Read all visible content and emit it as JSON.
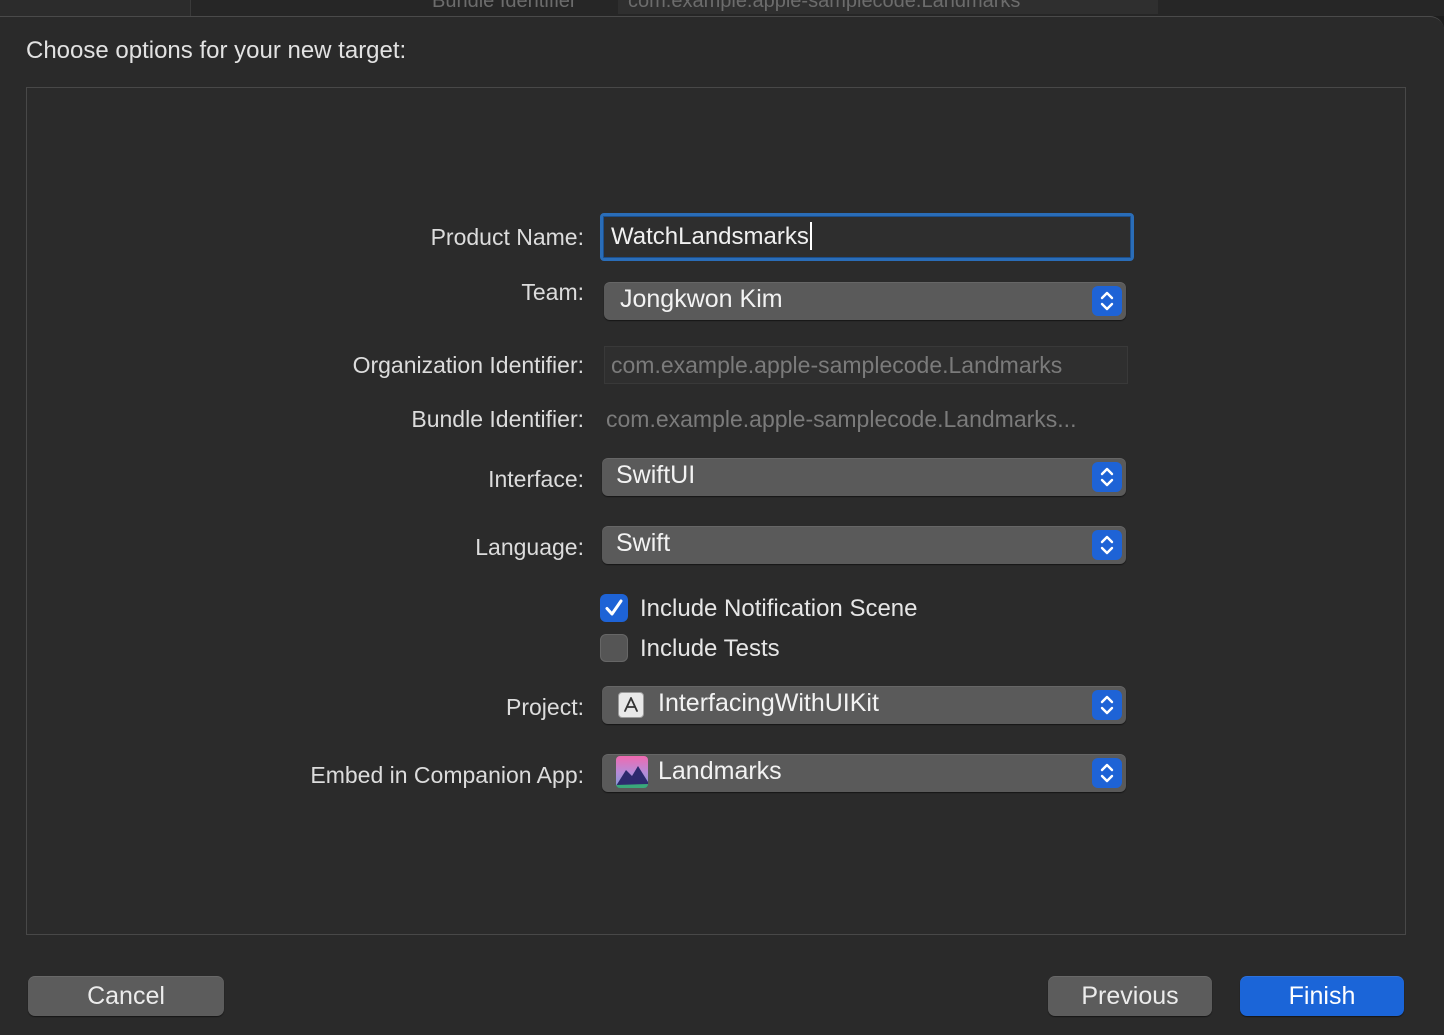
{
  "background_window": {
    "label": "Bundle Identifier",
    "value": "com.example.apple-samplecode.Landmarks"
  },
  "sheet": {
    "title": "Choose options for your new target:"
  },
  "form": {
    "product_name": {
      "label": "Product Name:",
      "value": "WatchLandsmarks"
    },
    "team": {
      "label": "Team:",
      "value": "Jongkwon Kim"
    },
    "organization_identifier": {
      "label": "Organization Identifier:",
      "placeholder": "com.example.apple-samplecode.Landmarks"
    },
    "bundle_identifier": {
      "label": "Bundle Identifier:",
      "value": "com.example.apple-samplecode.Landmarks..."
    },
    "interface": {
      "label": "Interface:",
      "value": "SwiftUI"
    },
    "language": {
      "label": "Language:",
      "value": "Swift"
    },
    "include_notification_scene": {
      "label": "Include Notification Scene",
      "checked": true
    },
    "include_tests": {
      "label": "Include Tests",
      "checked": false
    },
    "project": {
      "label": "Project:",
      "value": "InterfacingWithUIKit",
      "icon": "xcode-project-icon"
    },
    "embed": {
      "label": "Embed in Companion App:",
      "value": "Landmarks",
      "icon": "landmarks-app-icon"
    }
  },
  "buttons": {
    "cancel": "Cancel",
    "previous": "Previous",
    "finish": "Finish"
  },
  "colors": {
    "accent": "#1e63d6",
    "focus_ring": "#2a6db8",
    "sheet_bg": "#2a2a2a"
  }
}
